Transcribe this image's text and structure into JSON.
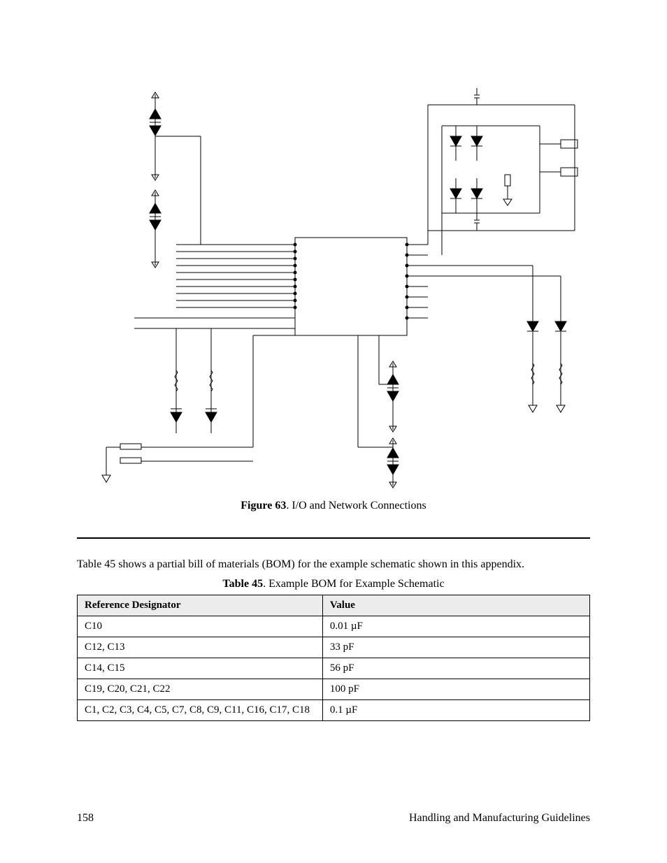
{
  "figure": {
    "label": "Figure 63",
    "caption_sep": ". ",
    "caption": "I/O and Network Connections"
  },
  "paragraph": "Table 45 shows a partial bill of materials (BOM) for the example schematic shown in this appendix.",
  "table": {
    "label": "Table 45",
    "caption_sep": ". ",
    "caption": "Example BOM for Example Schematic",
    "headers": {
      "col1": "Reference Designator",
      "col2": "Value"
    },
    "rows": [
      {
        "col1": "C10",
        "col2": "0.01 µF"
      },
      {
        "col1": "C12, C13",
        "col2": "33 pF"
      },
      {
        "col1": "C14, C15",
        "col2": "56 pF"
      },
      {
        "col1": "C19, C20, C21, C22",
        "col2": "100 pF"
      },
      {
        "col1": "C1, C2, C3, C4, C5, C7, C8, C9, C11, C16, C17, C18",
        "col2": "0.1 µF"
      }
    ]
  },
  "footer": {
    "page": "158",
    "title": "Handling and Manufacturing Guidelines"
  }
}
